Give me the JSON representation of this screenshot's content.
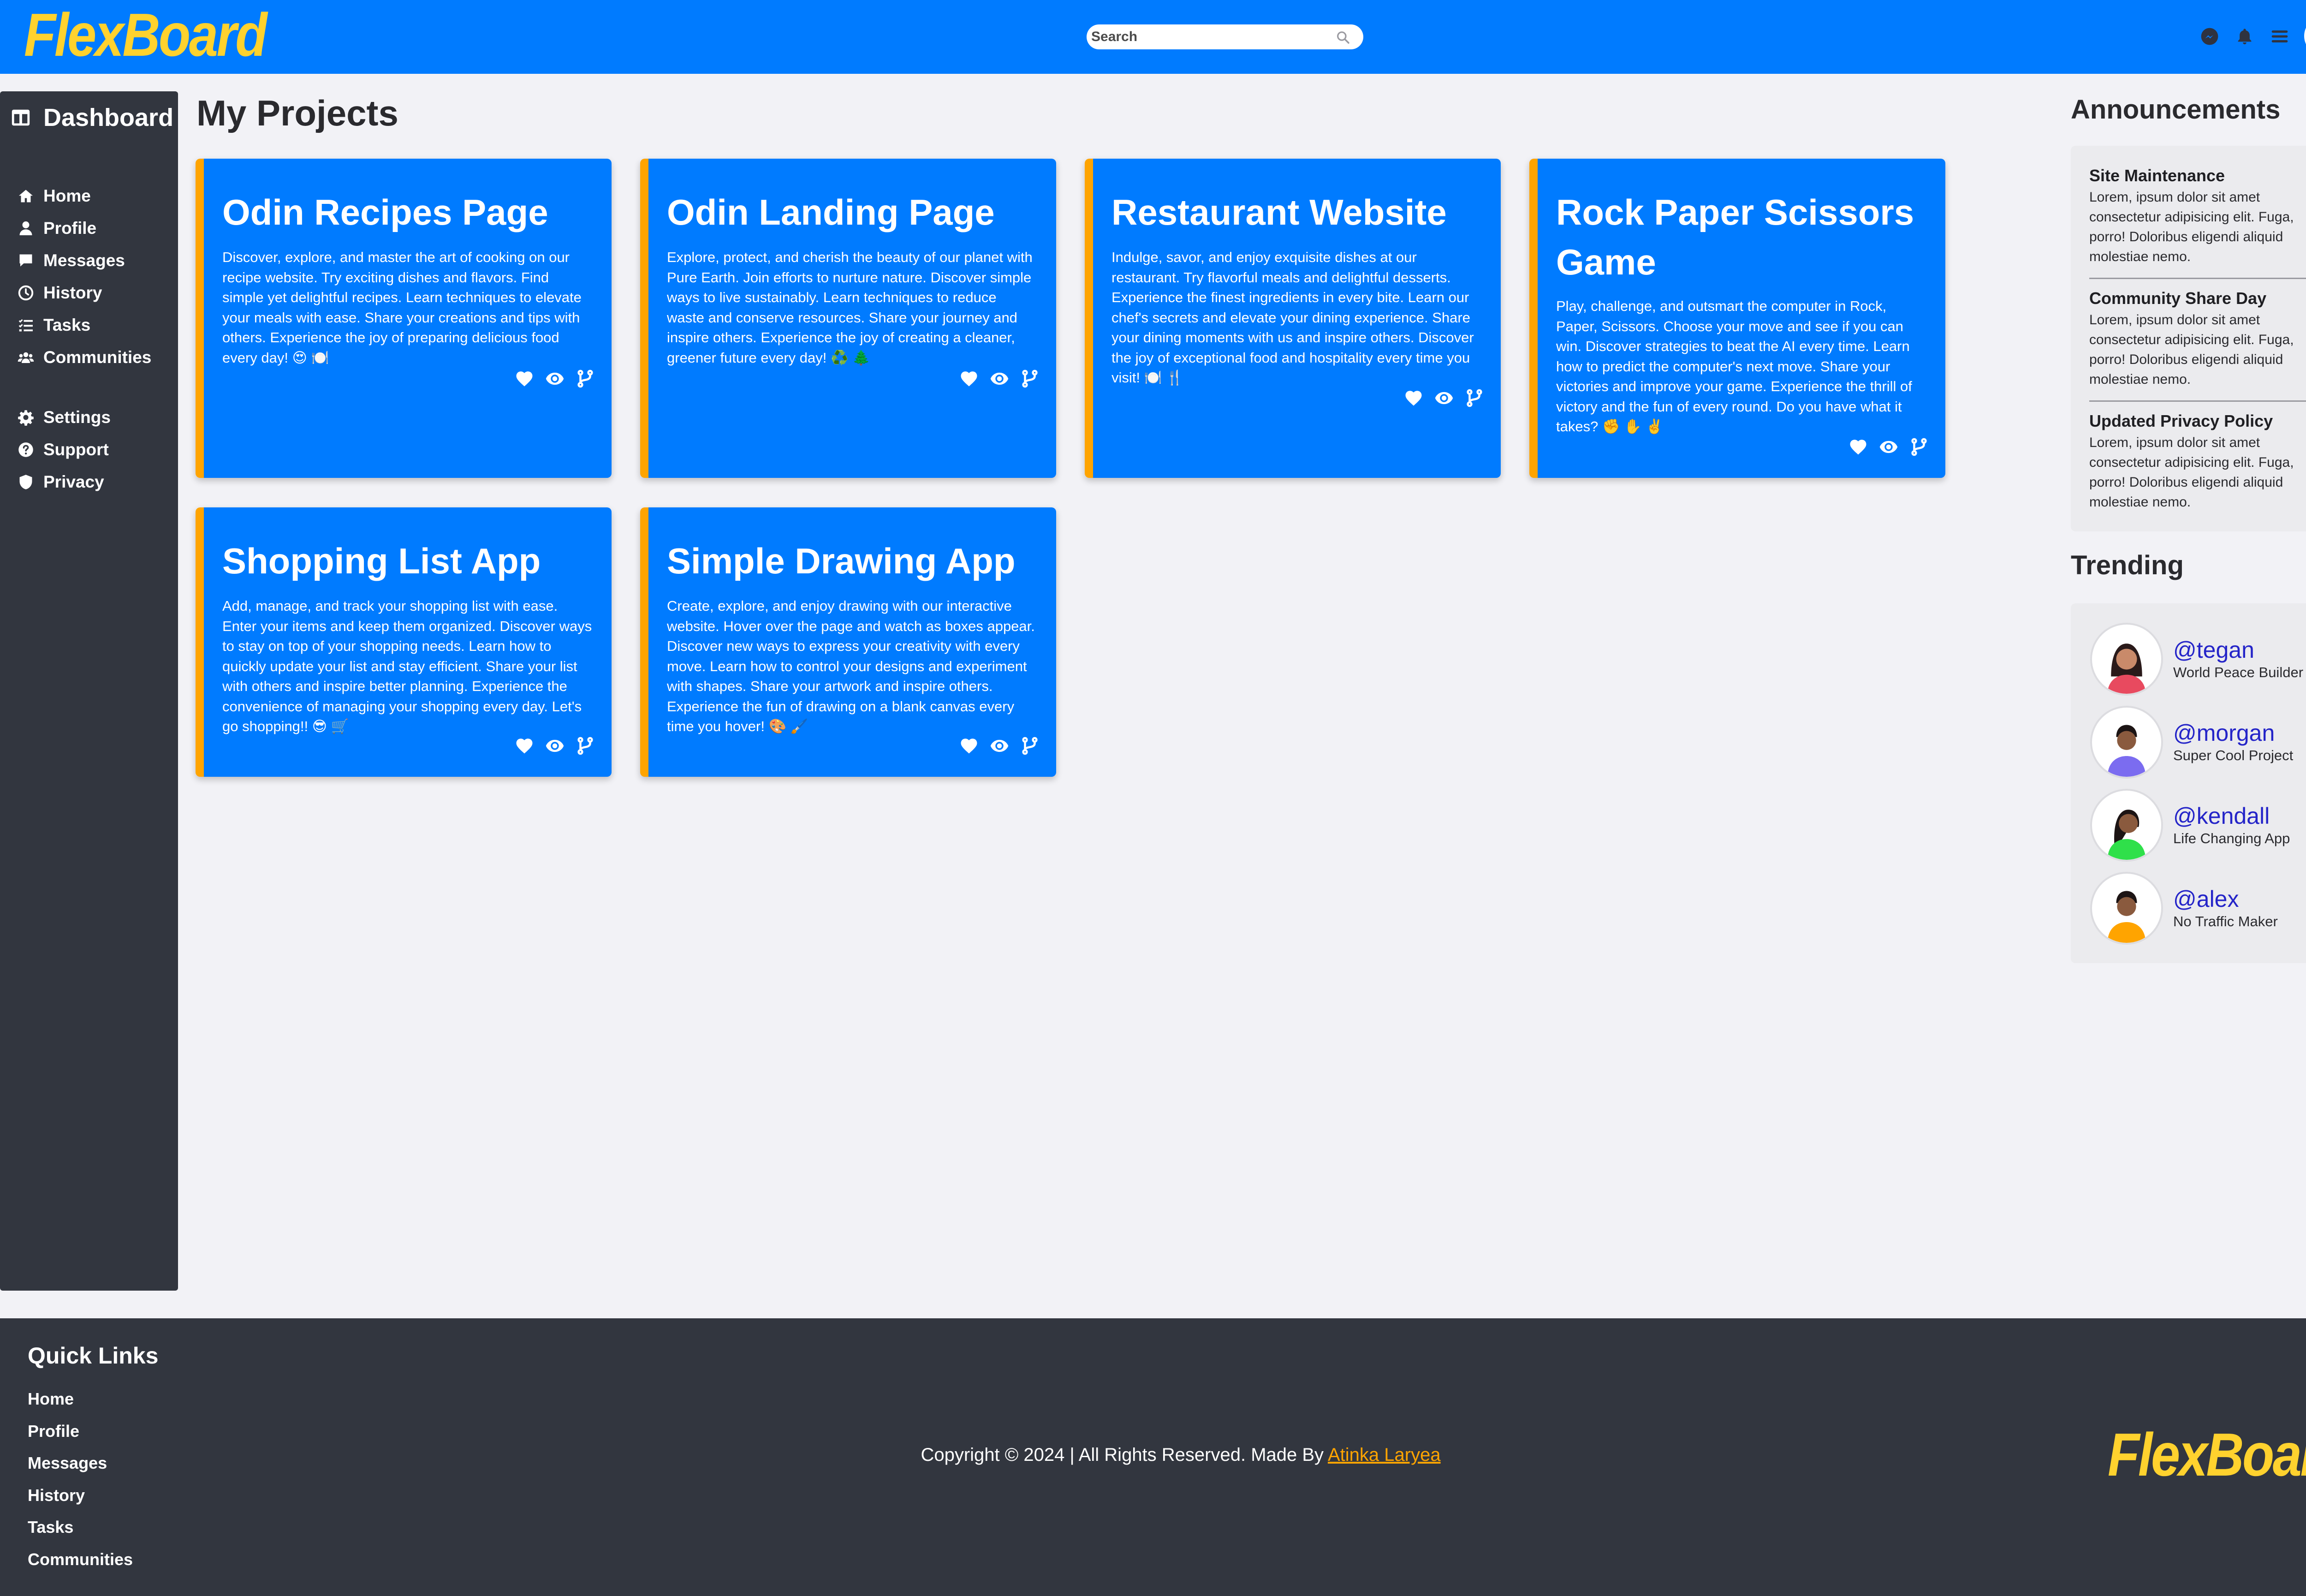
{
  "header": {
    "logo": "FlexBoard",
    "search_placeholder": "Search",
    "icons": [
      "messenger-icon",
      "bell-icon",
      "menu-icon"
    ]
  },
  "sidebar": {
    "title": "Dashboard",
    "items": [
      {
        "label": "Home",
        "icon": "home-icon"
      },
      {
        "label": "Profile",
        "icon": "user-icon"
      },
      {
        "label": "Messages",
        "icon": "message-icon"
      },
      {
        "label": "History",
        "icon": "clock-icon"
      },
      {
        "label": "Tasks",
        "icon": "tasks-icon"
      },
      {
        "label": "Communities",
        "icon": "users-icon"
      }
    ],
    "secondary_items": [
      {
        "label": "Settings",
        "icon": "gear-icon"
      },
      {
        "label": "Support",
        "icon": "question-icon"
      },
      {
        "label": "Privacy",
        "icon": "shield-icon"
      }
    ]
  },
  "main": {
    "title": "My Projects",
    "projects": [
      {
        "title": "Odin Recipes Page",
        "description": "Discover, explore, and master the art of cooking on our recipe website. Try exciting dishes and flavors. Find simple yet delightful recipes. Learn techniques to elevate your meals with ease. Share your creations and tips with others. Experience the joy of preparing delicious food every day! 😍 🍽️"
      },
      {
        "title": "Odin Landing Page",
        "description": "Explore, protect, and cherish the beauty of our planet with Pure Earth. Join efforts to nurture nature. Discover simple ways to live sustainably. Learn techniques to reduce waste and conserve resources. Share your journey and inspire others. Experience the joy of creating a cleaner, greener future every day! ♻️ 🌲"
      },
      {
        "title": "Restaurant Website",
        "description": "Indulge, savor, and enjoy exquisite dishes at our restaurant. Try flavorful meals and delightful desserts. Experience the finest ingredients in every bite. Learn our chef's secrets and elevate your dining experience. Share your dining moments with us and inspire others. Discover the joy of exceptional food and hospitality every time you visit! 🍽️ 🍴"
      },
      {
        "title": "Rock Paper Scissors Game",
        "description": "Play, challenge, and outsmart the computer in Rock, Paper, Scissors. Choose your move and see if you can win. Discover strategies to beat the AI every time. Learn how to predict the computer's next move. Share your victories and improve your game. Experience the thrill of victory and the fun of every round. Do you have what it takes? ✊ ✋ ✌️"
      },
      {
        "title": "Shopping List App",
        "description": "Add, manage, and track your shopping list with ease. Enter your items and keep them organized. Discover ways to stay on top of your shopping needs. Learn how to quickly update your list and stay efficient. Share your list with others and inspire better planning. Experience the convenience of managing your shopping every day. Let's go shopping!! 😎 🛒"
      },
      {
        "title": "Simple Drawing App",
        "description": "Create, explore, and enjoy drawing with our interactive website. Hover over the page and watch as boxes appear. Discover new ways to express your creativity with every move. Learn how to control your designs and experiment with shapes. Share your artwork and inspire others. Experience the fun of drawing on a blank canvas every time you hover! 🎨 🖌️"
      }
    ]
  },
  "announcements": {
    "title": "Announcements",
    "items": [
      {
        "title": "Site Maintenance",
        "body": "Lorem, ipsum dolor sit amet consectetur adipisicing elit. Fuga, porro! Doloribus eligendi aliquid molestiae nemo."
      },
      {
        "title": "Community Share Day",
        "body": "Lorem, ipsum dolor sit amet consectetur adipisicing elit. Fuga, porro! Doloribus eligendi aliquid molestiae nemo."
      },
      {
        "title": "Updated Privacy Policy",
        "body": "Lorem, ipsum dolor sit amet consectetur adipisicing elit. Fuga, porro! Doloribus eligendi aliquid molestiae nemo."
      }
    ]
  },
  "trending": {
    "title": "Trending",
    "items": [
      {
        "handle": "@tegan",
        "project": "World Peace Builder"
      },
      {
        "handle": "@morgan",
        "project": "Super Cool Project"
      },
      {
        "handle": "@kendall",
        "project": "Life Changing App"
      },
      {
        "handle": "@alex",
        "project": "No Traffic Maker"
      }
    ]
  },
  "footer": {
    "quick_links_title": "Quick Links",
    "links": [
      "Home",
      "Profile",
      "Messages",
      "History",
      "Tasks",
      "Communities"
    ],
    "copyright": "Copyright © 2024 | All Rights Reserved. Made By ",
    "author": "Atinka Laryea",
    "logo": "FlexBoard"
  },
  "colors": {
    "primary": "#007bff",
    "accent": "#ffa400",
    "logo": "#ffd22e",
    "dark": "#32363f",
    "background": "#f2f2f6"
  }
}
